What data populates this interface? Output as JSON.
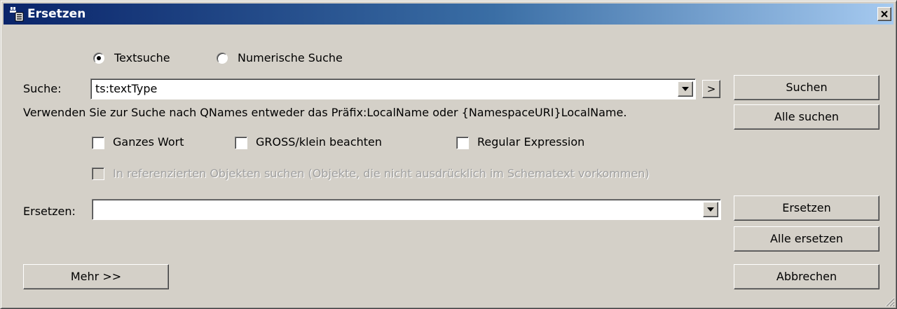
{
  "window": {
    "title": "Ersetzen",
    "close_label": "×"
  },
  "search_mode": {
    "options": [
      {
        "label": "Textsuche",
        "selected": true
      },
      {
        "label": "Numerische Suche",
        "selected": false
      }
    ]
  },
  "search": {
    "label": "Suche:",
    "value": "ts:textType",
    "next_label": ">",
    "hint": "Verwenden Sie zur Suche nach QNames entweder das Präfix:LocalName oder {NamespaceURI}LocalName."
  },
  "options": {
    "whole_word": {
      "label": "Ganzes Wort",
      "checked": false
    },
    "match_case": {
      "label": "GROSS/klein beachten",
      "checked": false
    },
    "regex": {
      "label": "Regular Expression",
      "checked": false
    },
    "referenced": {
      "label": "In referenzierten Objekten suchen (Objekte, die nicht ausdrücklich im Schematext vorkommen)",
      "checked": false,
      "disabled": true
    }
  },
  "replace": {
    "label": "Ersetzen:",
    "value": ""
  },
  "buttons": {
    "find": "Suchen",
    "find_all": "Alle suchen",
    "replace": "Ersetzen",
    "replace_all": "Alle ersetzen",
    "more": "Mehr >>",
    "cancel": "Abbrechen"
  },
  "colors": {
    "dialog_bg": "#d4d0c8",
    "title_gradient_start": "#0a246a",
    "title_gradient_end": "#a6caf0",
    "disabled_text": "#a0a0a0"
  },
  "icons": {
    "title": "replace-dialog-icon",
    "dropdown": "chevron-down-icon",
    "resize": "resize-grip-icon"
  }
}
